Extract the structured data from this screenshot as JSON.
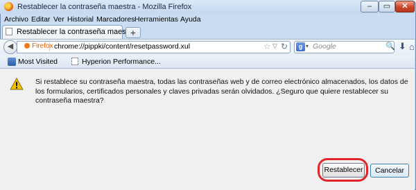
{
  "window": {
    "title": "Restablecer la contraseña maestra - Mozilla Firefox",
    "controls": {
      "minimize": "‒",
      "maximize": "▭",
      "close": "✕"
    }
  },
  "menu": [
    "Archivo",
    "Editar",
    "Ver",
    "Historial",
    "Marcadores",
    "Herramientas",
    "Ayuda"
  ],
  "tabs": {
    "active_label": "Restablecer la contraseña maestra",
    "new_tab": "+"
  },
  "navbar": {
    "identity_label": "Firefox",
    "url": "chrome://pippki/content/resetpassword.xul",
    "search_placeholder": "Google",
    "search_engine_letter": "g"
  },
  "bookmarks": [
    {
      "label": "Most Visited",
      "icon": "most-visited-icon"
    },
    {
      "label": "Hyperion Performance...",
      "icon": "page-icon"
    }
  ],
  "dialog": {
    "message": "Si restablece su contraseña maestra, todas las contraseñas web y de correo electrónico almacenados, los datos de los formularios, certificados personales y claves privadas serán olvidados. ¿Seguro que quiere restablecer su contraseña maestra?",
    "reset_label": "Restablecer",
    "cancel_label": "Cancelar"
  },
  "colors": {
    "highlight": "#e0262b",
    "warning": "#f2c200"
  }
}
